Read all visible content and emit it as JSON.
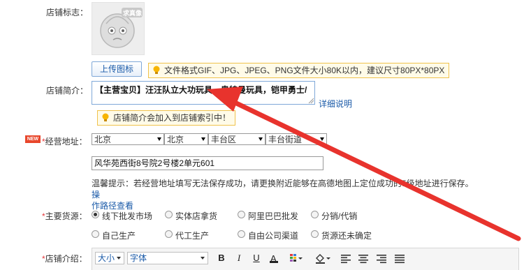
{
  "shop_logo": {
    "label": "店铺标志：",
    "placeholder_tag": "求真像",
    "upload_button": "上传图标",
    "format_tip": "文件格式GIF、JPG、JPEG、PNG文件大小80K以内，建议尺寸80PX*80PX"
  },
  "shop_intro": {
    "label": "店铺简介：",
    "value": "【主营宝贝】汪汪队立大功玩具，奥特曼玩具，铠甲勇士/",
    "detail_link": "详细说明",
    "index_tip": "店铺简介会加入到店铺索引中！"
  },
  "address": {
    "badge": "NEW",
    "required_mark": "*",
    "label": "经营地址：",
    "province": "北京",
    "city": "北京",
    "district": "丰台区",
    "street": "丰台街道",
    "detail_value": "风华苑西街8号院2号楼2单元601",
    "notice": "温馨提示：若经营地址填写无法保存成功，请更换附近能够在高德地图上定位成功的5级地址进行保存。",
    "notice_link_1": "操",
    "notice_link_2": "作路径查看"
  },
  "supply": {
    "required_mark": "*",
    "label": "主要货源：",
    "options": [
      {
        "label": "线下批发市场",
        "selected": true
      },
      {
        "label": "实体店拿货",
        "selected": false
      },
      {
        "label": "阿里巴巴批发",
        "selected": false
      },
      {
        "label": "分销/代销",
        "selected": false
      },
      {
        "label": "自己生产",
        "selected": false
      },
      {
        "label": "代工生产",
        "selected": false
      },
      {
        "label": "自由公司渠道",
        "selected": false
      },
      {
        "label": "货源还未确定",
        "selected": false
      }
    ]
  },
  "shop_desc": {
    "required_mark": "*",
    "label": "店铺介绍：",
    "size_select": "大小",
    "font_select": "字体"
  },
  "icons": [
    "lightbulb-icon",
    "bold-icon",
    "italic-icon",
    "underline-icon",
    "strikethrough-icon",
    "table-icon",
    "fill-color-icon",
    "align-left-icon",
    "align-center-icon",
    "align-right-icon",
    "align-justify-icon"
  ],
  "colors": {
    "accent_blue": "#1a5aa8",
    "required_red": "#e4393c",
    "arrow_red": "#e8332d",
    "tip_bg": "#fffbe8",
    "tip_border": "#f0c24b"
  }
}
